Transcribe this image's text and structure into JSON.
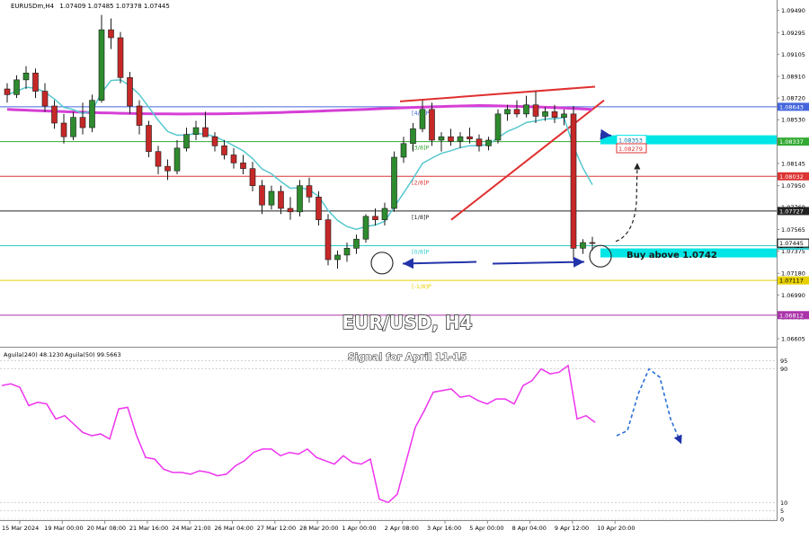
{
  "header": {
    "symbol": "EURUSDm,H4",
    "ohlc": "1.07409 1.07485 1.07378 1.07445"
  },
  "title": "EUR/USD, H4",
  "subtitle": "Signal for April 11-15",
  "annotation": "Buy above 1.0742",
  "indicator_labels": [
    "Aguila(240) 48.1230",
    "Aguila(50) 99.5663"
  ],
  "murray_labels": [
    "[4/8]P",
    "[3/8]P",
    "[2/8]P",
    "[1/8]P",
    "[0/8]P",
    "[-1/8]P"
  ],
  "colors": {
    "candle_bull": "#2e8b2e",
    "candle_bear": "#c62828",
    "ema_slow": "#d63fd6",
    "ema_fast": "#55c8cf",
    "oscillator": "#ee33ee",
    "wedge": "#e03030",
    "arrow": "#2233aa",
    "highlight": "#00e5e5"
  },
  "chart_data": [
    {
      "type": "candlestick",
      "y_axis_ticks": [
        "1.09490",
        "1.09295",
        "1.09105",
        "1.08910",
        "1.08720",
        "1.08530",
        "1.08335",
        "1.08145",
        "1.07950",
        "1.07760",
        "1.07565",
        "1.07375",
        "1.07180",
        "1.06990",
        "1.06795",
        "1.06605"
      ],
      "ylim": [
        1.0655,
        1.0955
      ],
      "x_tick_labels": [
        "15 Mar 2024",
        "19 Mar 00:00",
        "20 Mar 08:00",
        "21 Mar 16:00",
        "24 Mar 21:00",
        "26 Mar 04:00",
        "27 Mar 12:00",
        "28 Mar 20:00",
        "1 Apr 00:00",
        "2 Apr 08:00",
        "3 Apr 16:00",
        "5 Apr 00:00",
        "8 Apr 04:00",
        "9 Apr 12:00",
        "10 Apr 20:00"
      ],
      "price_levels": [
        {
          "label": "[4/8]P",
          "value": 1.08643,
          "tag": "1.08643",
          "color": "#4466dd"
        },
        {
          "label": "[3/8]P",
          "value": 1.08337,
          "tag": "1.08337",
          "color": "#33aa33"
        },
        {
          "label": "[2/8]P",
          "value": 1.08032,
          "tag": "1.08032",
          "color": "#dd3333"
        },
        {
          "label": "[1/8]P",
          "value": 1.07727,
          "tag": "1.07727",
          "color": "#222222"
        },
        {
          "label": "[0/8]P",
          "value": 1.07422,
          "tag": "1.07422",
          "color": "#33cccc"
        },
        {
          "label": "[-1/8]P",
          "value": 1.07117,
          "tag": "1.07117",
          "color": "#e8d000"
        },
        {
          "label": "",
          "value": 1.06812,
          "tag": "1.06812",
          "color": "#aa33aa"
        }
      ],
      "targets": [
        {
          "value": 1.08353,
          "tag": "1.08353",
          "color": "#00e5e5"
        },
        {
          "value": 1.08279,
          "tag": "1.08279",
          "color": "#dd3333"
        }
      ],
      "current_price": {
        "value": 1.07445,
        "tag": "1.07445"
      },
      "candles": [
        [
          1.088,
          1.0885,
          1.0868,
          1.0875
        ],
        [
          1.0875,
          1.0892,
          1.0872,
          1.0888
        ],
        [
          1.0888,
          1.09,
          1.088,
          1.0894
        ],
        [
          1.0894,
          1.0898,
          1.0872,
          1.0878
        ],
        [
          1.0878,
          1.0885,
          1.086,
          1.0865
        ],
        [
          1.0865,
          1.087,
          1.0845,
          1.085
        ],
        [
          1.085,
          1.0858,
          1.0832,
          1.0838
        ],
        [
          1.0838,
          1.086,
          1.0835,
          1.0855
        ],
        [
          1.0855,
          1.0868,
          1.084,
          1.0846
        ],
        [
          1.0846,
          1.0875,
          1.0842,
          1.087
        ],
        [
          1.087,
          1.0945,
          1.0868,
          1.0932
        ],
        [
          1.0932,
          1.0942,
          1.0915,
          1.0925
        ],
        [
          1.0925,
          1.093,
          1.0885,
          1.089
        ],
        [
          1.089,
          1.0895,
          1.0858,
          1.0865
        ],
        [
          1.0865,
          1.087,
          1.084,
          1.0848
        ],
        [
          1.0848,
          1.0852,
          1.082,
          1.0825
        ],
        [
          1.0825,
          1.083,
          1.0805,
          1.0812
        ],
        [
          1.0812,
          1.0818,
          1.08,
          1.0808
        ],
        [
          1.0808,
          1.0835,
          1.0805,
          1.0828
        ],
        [
          1.0828,
          1.0846,
          1.0825,
          1.084
        ],
        [
          1.084,
          1.0852,
          1.0835,
          1.0846
        ],
        [
          1.0846,
          1.086,
          1.084,
          1.0838
        ],
        [
          1.0838,
          1.0842,
          1.0825,
          1.083
        ],
        [
          1.083,
          1.0835,
          1.0818,
          1.0822
        ],
        [
          1.0822,
          1.0828,
          1.081,
          1.0815
        ],
        [
          1.0815,
          1.0822,
          1.0805,
          1.081
        ],
        [
          1.081,
          1.0816,
          1.079,
          1.0795
        ],
        [
          1.0795,
          1.08,
          1.077,
          1.0778
        ],
        [
          1.0778,
          1.0795,
          1.0774,
          1.079
        ],
        [
          1.079,
          1.0795,
          1.077,
          1.0775
        ],
        [
          1.0775,
          1.0785,
          1.0765,
          1.0772
        ],
        [
          1.0772,
          1.08,
          1.0768,
          1.0795
        ],
        [
          1.0795,
          1.0802,
          1.078,
          1.0785
        ],
        [
          1.0785,
          1.079,
          1.076,
          1.0765
        ],
        [
          1.0765,
          1.077,
          1.0725,
          1.073
        ],
        [
          1.073,
          1.0738,
          1.0722,
          1.0734
        ],
        [
          1.0734,
          1.0745,
          1.0728,
          1.074
        ],
        [
          1.074,
          1.0752,
          1.0735,
          1.0748
        ],
        [
          1.0748,
          1.077,
          1.0745,
          1.0768
        ],
        [
          1.0768,
          1.0775,
          1.076,
          1.0765
        ],
        [
          1.0765,
          1.078,
          1.076,
          1.0775
        ],
        [
          1.0775,
          1.0825,
          1.0772,
          1.082
        ],
        [
          1.082,
          1.0838,
          1.0815,
          1.0832
        ],
        [
          1.0832,
          1.085,
          1.0825,
          1.0845
        ],
        [
          1.0845,
          1.087,
          1.0842,
          1.0862
        ],
        [
          1.0862,
          1.0868,
          1.083,
          1.0835
        ],
        [
          1.0835,
          1.0842,
          1.0825,
          1.0838
        ],
        [
          1.0838,
          1.0845,
          1.083,
          1.0834
        ],
        [
          1.0834,
          1.0842,
          1.0828,
          1.0838
        ],
        [
          1.0838,
          1.0846,
          1.0832,
          1.0836
        ],
        [
          1.0836,
          1.084,
          1.0825,
          1.083
        ],
        [
          1.083,
          1.0838,
          1.0826,
          1.0835
        ],
        [
          1.0835,
          1.0862,
          1.0832,
          1.0858
        ],
        [
          1.0858,
          1.0866,
          1.0852,
          1.0862
        ],
        [
          1.0862,
          1.087,
          1.0855,
          1.0858
        ],
        [
          1.0858,
          1.0874,
          1.0855,
          1.0866
        ],
        [
          1.0866,
          1.0878,
          1.085,
          1.0856
        ],
        [
          1.0856,
          1.0864,
          1.0852,
          1.086
        ],
        [
          1.086,
          1.0866,
          1.085,
          1.0855
        ],
        [
          1.0855,
          1.0862,
          1.0848,
          1.0858
        ],
        [
          1.0858,
          1.0865,
          1.073,
          1.074
        ],
        [
          1.074,
          1.0748,
          1.0735,
          1.0745
        ],
        [
          1.0745,
          1.075,
          1.0738,
          1.07445
        ]
      ]
    },
    {
      "type": "line",
      "name": "Aguila",
      "ylim": [
        0,
        100
      ],
      "y_axis_ticks": [
        "95",
        "90",
        "10",
        "5",
        "0"
      ],
      "values": [
        80,
        81,
        79,
        68,
        70,
        69,
        60,
        62,
        57,
        52,
        50,
        51,
        48,
        66,
        67,
        50,
        37,
        36,
        30,
        28,
        28,
        27,
        29,
        28,
        26,
        27,
        32,
        35,
        40,
        42,
        42,
        38,
        40,
        39,
        42,
        37,
        35,
        33,
        38,
        34,
        33,
        36,
        12,
        10,
        15,
        35,
        55,
        65,
        76,
        77,
        78,
        73,
        74,
        71,
        69,
        72,
        72,
        69,
        80,
        83,
        90,
        87,
        88,
        92,
        60,
        62,
        58
      ],
      "projected": [
        [
          0,
          50
        ],
        [
          1,
          53
        ],
        [
          2,
          75
        ],
        [
          3,
          90
        ],
        [
          4,
          85
        ],
        [
          5,
          60
        ],
        [
          6,
          45
        ]
      ]
    }
  ]
}
